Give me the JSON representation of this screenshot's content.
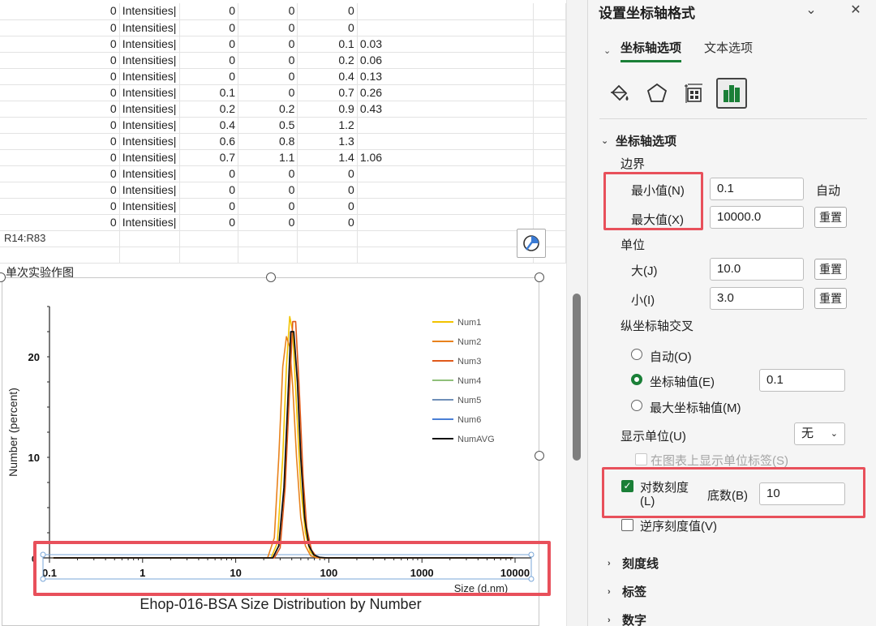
{
  "sheet": {
    "rows": [
      [
        "0",
        "Intensities|",
        "0",
        "0",
        "0",
        ""
      ],
      [
        "0",
        "Intensities|",
        "0",
        "0",
        "0",
        ""
      ],
      [
        "0",
        "Intensities|",
        "0",
        "0",
        "0.1",
        "0.03"
      ],
      [
        "0",
        "Intensities|",
        "0",
        "0",
        "0.2",
        "0.06"
      ],
      [
        "0",
        "Intensities|",
        "0",
        "0",
        "0.4",
        "0.13"
      ],
      [
        "0",
        "Intensities|",
        "0.1",
        "0",
        "0.7",
        "0.26"
      ],
      [
        "0",
        "Intensities|",
        "0.2",
        "0.2",
        "0.9",
        "0.43"
      ],
      [
        "0",
        "Intensities|",
        "0.4",
        "0.5",
        "1.2",
        ""
      ],
      [
        "0",
        "Intensities|",
        "0.6",
        "0.8",
        "1.3",
        ""
      ],
      [
        "0",
        "Intensities|",
        "0.7",
        "1.1",
        "1.4",
        "1.06"
      ],
      [
        "0",
        "Intensities|",
        "0",
        "0",
        "0",
        ""
      ],
      [
        "0",
        "Intensities|",
        "0",
        "0",
        "0",
        ""
      ],
      [
        "0",
        "Intensities|",
        "0",
        "0",
        "0",
        ""
      ],
      [
        "0",
        "Intensities|",
        "0",
        "0",
        "0",
        ""
      ]
    ],
    "range_label": "R14:R83",
    "chart_caption": "单次实验作图"
  },
  "chart_data": {
    "type": "line",
    "title": "Ehop-016-BSA Size Distribution by Number",
    "xlabel": "Size (d.nm)",
    "ylabel": "Number (percent)",
    "x_scale": "log",
    "xlim": [
      0.1,
      10000
    ],
    "ylim": [
      0,
      25
    ],
    "x_ticks": [
      "0.1",
      "1",
      "10",
      "100",
      "1000",
      "10000"
    ],
    "y_ticks": [
      "0",
      "10",
      "20"
    ],
    "legend_position": "right",
    "series": [
      {
        "name": "Num1",
        "color": "#f2c300",
        "x": [
          24,
          28,
          32,
          35,
          38,
          41,
          45,
          50,
          56,
          63,
          72,
          85
        ],
        "y": [
          0,
          1.5,
          10,
          19,
          24,
          22.5,
          15,
          7,
          2.5,
          0.6,
          0.1,
          0
        ]
      },
      {
        "name": "Num2",
        "color": "#e8821c",
        "x": [
          22,
          26,
          29,
          32,
          35,
          38,
          41,
          45,
          50,
          56,
          64,
          75
        ],
        "y": [
          0,
          2,
          10,
          19,
          22,
          21,
          17,
          10,
          4,
          1.2,
          0.2,
          0
        ]
      },
      {
        "name": "Num3",
        "color": "#e05a1a",
        "x": [
          26,
          30,
          34,
          38,
          41,
          44,
          48,
          53,
          58,
          65,
          74,
          88
        ],
        "y": [
          0,
          1,
          7,
          17,
          23.5,
          23.5,
          17,
          8,
          3,
          0.8,
          0.1,
          0
        ]
      },
      {
        "name": "Num4",
        "color": "#8fc07a",
        "x": [],
        "y": []
      },
      {
        "name": "Num5",
        "color": "#6f8fb8",
        "x": [],
        "y": []
      },
      {
        "name": "Num6",
        "color": "#4a7fd6",
        "x": [],
        "y": []
      },
      {
        "name": "NumAVG",
        "color": "#111111",
        "x": [
          25,
          29,
          33,
          36,
          39,
          42,
          46,
          50,
          55,
          61,
          69,
          80,
          95
        ],
        "y": [
          0,
          1.2,
          7,
          15,
          22.5,
          22.5,
          17.5,
          10,
          4,
          1.2,
          0.3,
          0.05,
          0
        ]
      }
    ]
  },
  "pane": {
    "title": "设置坐标轴格式",
    "tabs": {
      "axis_options": "坐标轴选项",
      "text_options": "文本选项"
    },
    "section_axis_options": "坐标轴选项",
    "bounds": {
      "label": "边界",
      "min_label": "最小值(N)",
      "min_value": "0.1",
      "min_state": "自动",
      "max_label": "最大值(X)",
      "max_value": "10000.0",
      "max_reset": "重置"
    },
    "units": {
      "label": "单位",
      "major_label": "大(J)",
      "major_value": "10.0",
      "major_reset": "重置",
      "minor_label": "小(I)",
      "minor_value": "3.0",
      "minor_reset": "重置"
    },
    "crosses": {
      "label": "纵坐标轴交叉",
      "auto": "自动(O)",
      "axis_value": "坐标轴值(E)",
      "axis_value_input": "0.1",
      "max_value": "最大坐标轴值(M)"
    },
    "display_units": {
      "label": "显示单位(U)",
      "value": "无",
      "show_label": "在图表上显示单位标签(S)"
    },
    "log": {
      "label_line1": "对数刻度",
      "label_line2": "(L)",
      "base_label": "底数(B)",
      "base_value": "10"
    },
    "reverse": "逆序刻度值(V)",
    "collapsed": [
      "刻度线",
      "标签",
      "数字"
    ]
  }
}
